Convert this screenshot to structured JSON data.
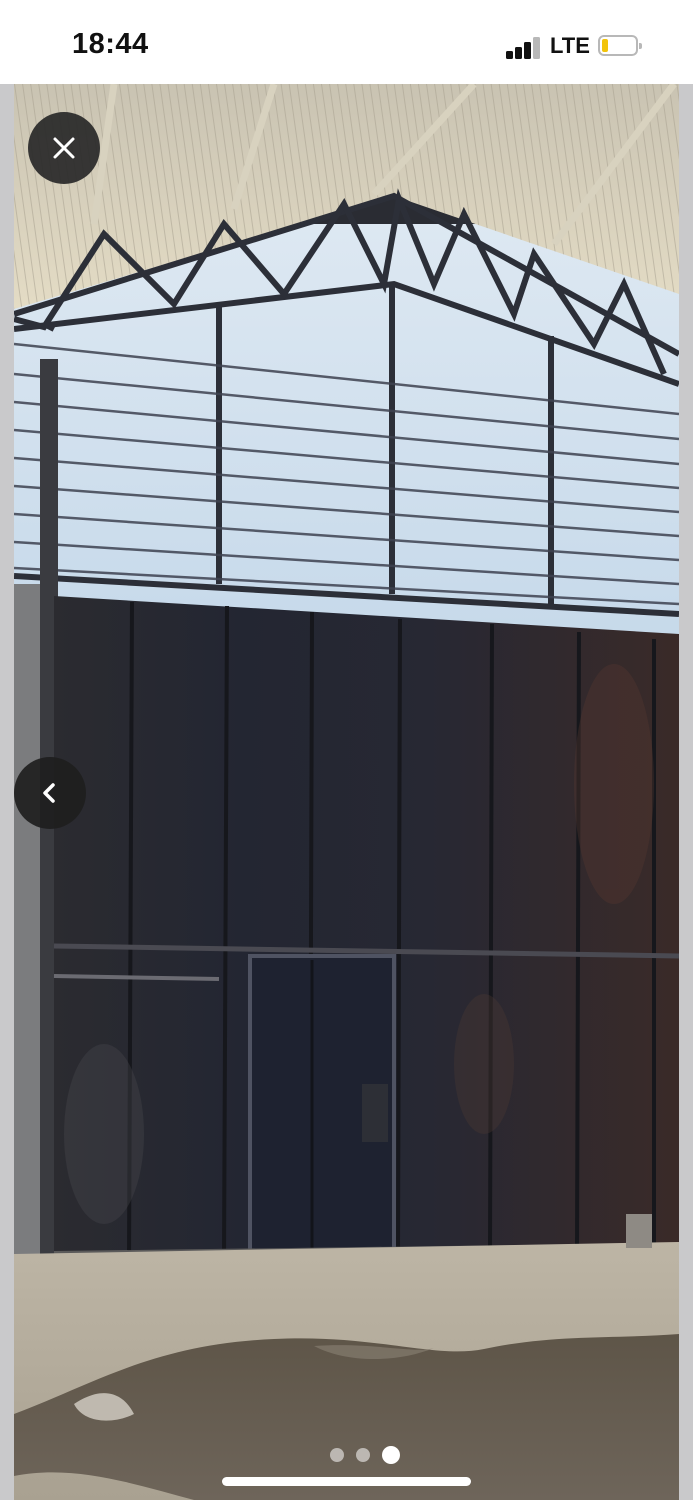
{
  "status_bar": {
    "time": "18:44",
    "network": "LTE",
    "signal_bars": 4,
    "battery_level": 0.2,
    "battery_color": "#f2c40b"
  },
  "viewer": {
    "close_icon": "close-icon",
    "prev_icon": "chevron-left-icon",
    "photo_subject": "warehouse-interior-photo",
    "pagination": {
      "total": 3,
      "current": 3
    }
  }
}
